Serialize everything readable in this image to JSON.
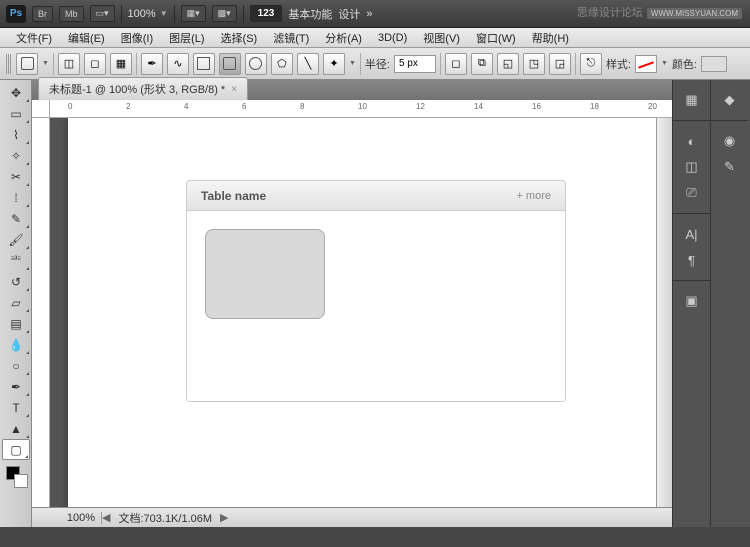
{
  "topbar": {
    "logo": "Ps",
    "br": "Br",
    "mb": "Mb",
    "zoom": "100%",
    "num": "123",
    "mode1": "基本功能",
    "mode2": "设计"
  },
  "watermark": {
    "text": "思缘设计论坛",
    "url": "WWW.MISSYUAN.COM"
  },
  "menu": [
    "文件(F)",
    "编辑(E)",
    "图像(I)",
    "图层(L)",
    "选择(S)",
    "滤镜(T)",
    "分析(A)",
    "3D(D)",
    "视图(V)",
    "窗口(W)",
    "帮助(H)"
  ],
  "optbar": {
    "radius_label": "半径:",
    "radius_value": "5 px",
    "style_label": "样式:",
    "color_label": "颜色:"
  },
  "tab": {
    "title": "未标题-1 @ 100% (形状 3, RGB/8) *"
  },
  "ruler_ticks": [
    "0",
    "2",
    "4",
    "6",
    "8",
    "10",
    "12",
    "14",
    "16",
    "18",
    "20"
  ],
  "design": {
    "title": "Table name",
    "more": "+ more"
  },
  "status": {
    "zoom": "100%",
    "doc_label": "文档:",
    "doc_value": "703.1K/1.06M"
  }
}
